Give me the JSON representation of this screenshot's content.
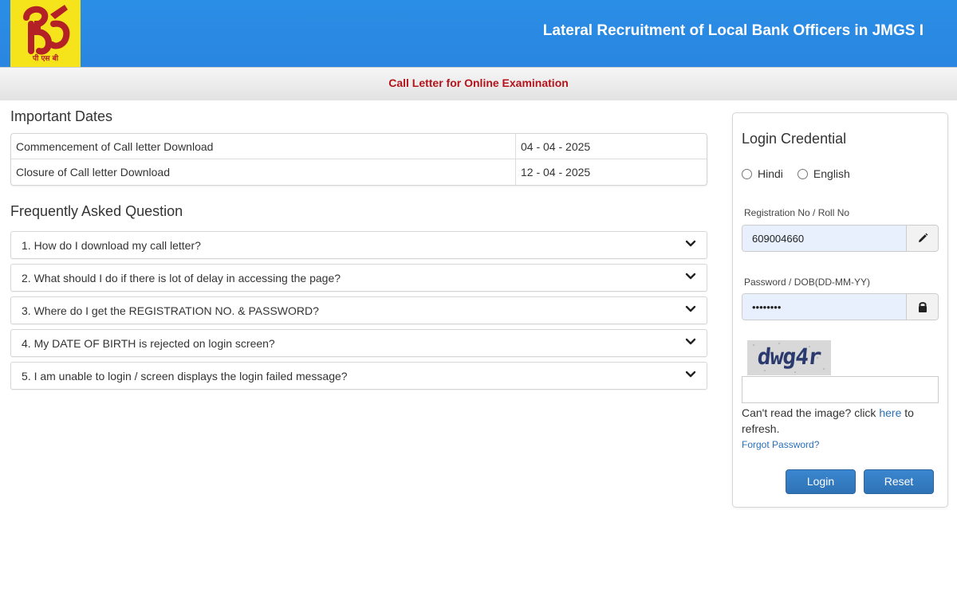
{
  "header": {
    "logo_text": "पी एस बी",
    "title": "Lateral Recruitment of Local Bank Officers in JMGS I",
    "brand_red": "#b32025",
    "brand_yellow": "#f5e31b"
  },
  "subbar": {
    "title": "Call Letter for Online Examination"
  },
  "important_dates": {
    "title": "Important Dates",
    "rows": [
      {
        "label": "Commencement of Call letter Download",
        "value": "04 - 04 - 2025"
      },
      {
        "label": "Closure of Call letter Download",
        "value": "12 - 04 - 2025"
      }
    ]
  },
  "faq": {
    "title": "Frequently Asked Question",
    "items": [
      "1. How do I download my call letter?",
      "2. What should I do if there is lot of delay in accessing the page?",
      "3. Where do I get the REGISTRATION NO. & PASSWORD?",
      "4. My DATE OF BIRTH is rejected on login screen?",
      "5. I am unable to login / screen displays the login failed message?"
    ]
  },
  "login": {
    "title": "Login Credential",
    "languages": [
      "Hindi",
      "English"
    ],
    "reg_label": "Registration No / Roll No",
    "reg_value": "609004660",
    "reg_icon": "pencil-icon",
    "pwd_label": "Password / DOB(DD-MM-YY)",
    "pwd_value": "••••••••",
    "pwd_icon": "lock-icon",
    "captcha_text": "dwg4r",
    "refresh_prefix": "Can't read the image? click ",
    "refresh_link": "here",
    "refresh_suffix": " to refresh.",
    "forgot": "Forgot Password?",
    "login_button": "Login",
    "reset_button": "Reset"
  }
}
